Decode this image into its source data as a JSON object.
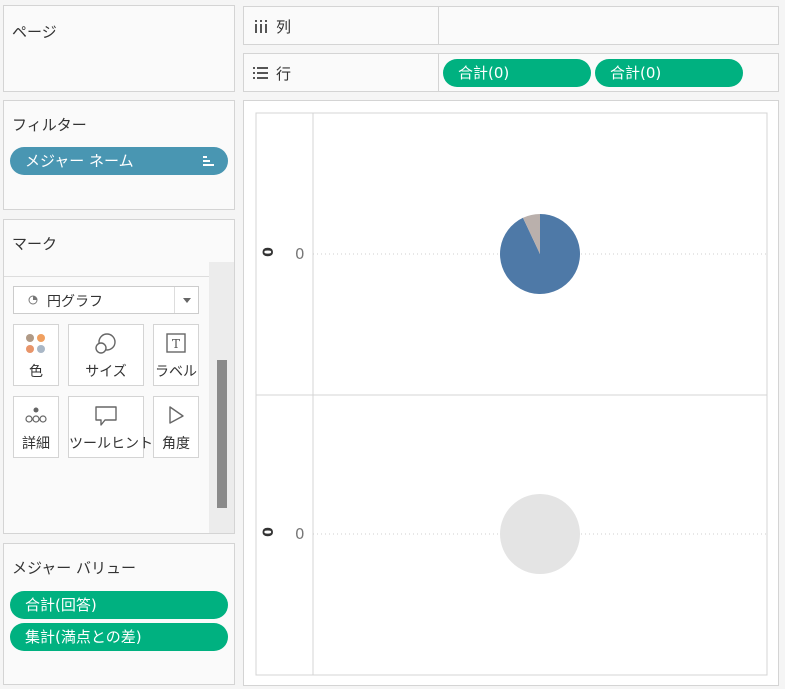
{
  "pages": {
    "title": "ページ"
  },
  "columns": {
    "icon": "columns-icon",
    "label": "列"
  },
  "rows": {
    "icon": "rows-icon",
    "label": "行",
    "pills": [
      {
        "label": "合計(0)"
      },
      {
        "label": "合計(0)"
      }
    ]
  },
  "filters": {
    "title": "フィルター",
    "pills": [
      {
        "label": "メジャー ネーム",
        "icon": "filter-sort-icon"
      }
    ]
  },
  "marks": {
    "title": "マーク",
    "mark_type": {
      "label": "円グラフ",
      "icon": "pie-icon"
    },
    "cards": [
      {
        "label": "色",
        "icon": "color-icon"
      },
      {
        "label": "サイズ",
        "icon": "size-icon"
      },
      {
        "label": "ラベル",
        "icon": "label-icon"
      },
      {
        "label": "詳細",
        "icon": "detail-icon"
      },
      {
        "label": "ツールヒント",
        "icon": "tooltip-icon"
      },
      {
        "label": "角度",
        "icon": "angle-icon"
      }
    ]
  },
  "measure_values": {
    "title": "メジャー バリュー",
    "pills": [
      {
        "label": "合計(回答)"
      },
      {
        "label": "集計(満点との差)"
      }
    ]
  },
  "colors": {
    "green": "#00b180",
    "blue_pill": "#4996b2",
    "pie_main": "#4e79a7",
    "pie_secondary": "#bab0ac",
    "pie_empty": "#e4e4e4"
  },
  "chart_data": [
    {
      "type": "pie",
      "row_label": "0",
      "axis_header": "0",
      "slices": [
        {
          "name": "",
          "fraction": 0.93,
          "color": "#4e79a7"
        },
        {
          "name": "",
          "fraction": 0.07,
          "color": "#bab0ac"
        }
      ]
    },
    {
      "type": "pie",
      "row_label": "0",
      "axis_header": "0",
      "slices": [
        {
          "name": "",
          "fraction": 1.0,
          "color": "#e4e4e4"
        }
      ]
    }
  ]
}
